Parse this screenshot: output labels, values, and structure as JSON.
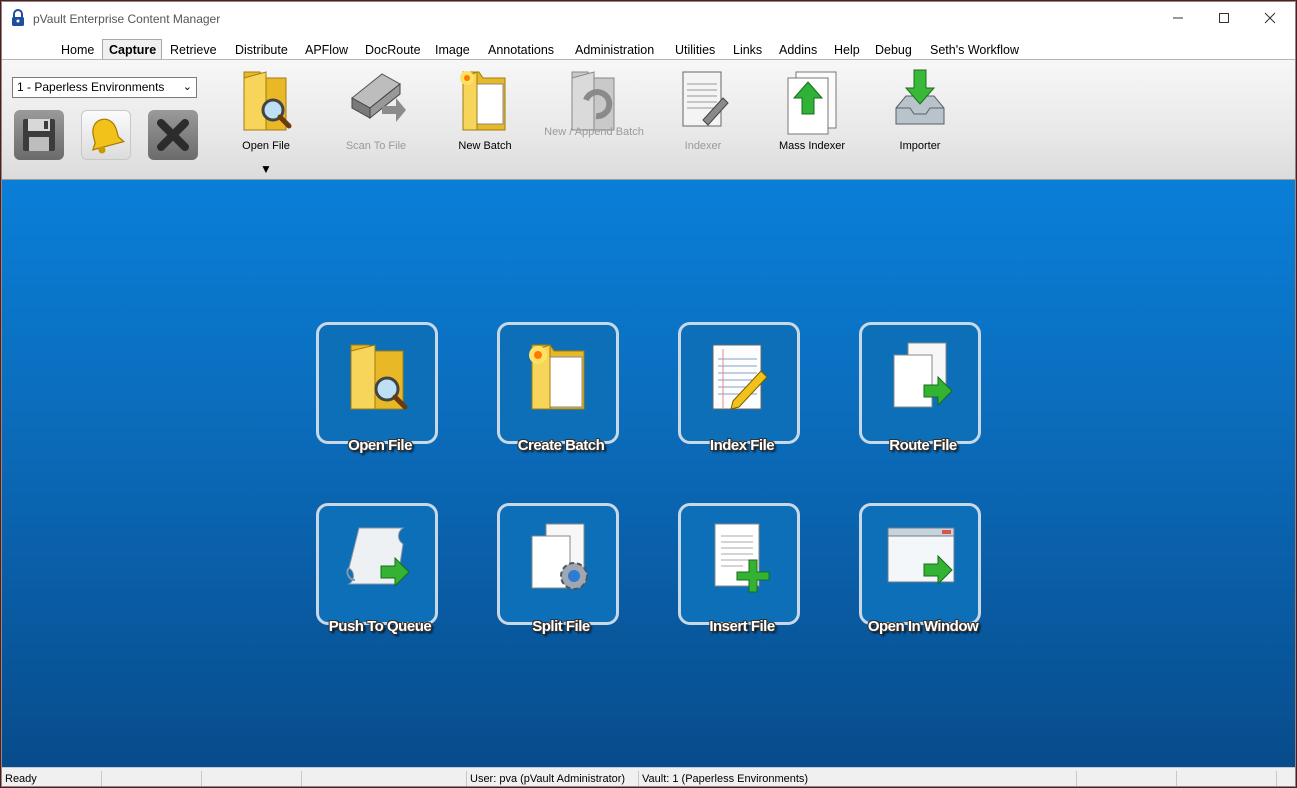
{
  "window": {
    "title": "pVault Enterprise Content Manager",
    "icon": "lock-icon"
  },
  "menu": {
    "tabs": [
      {
        "label": "Home"
      },
      {
        "label": "Capture",
        "active": true
      },
      {
        "label": "Retrieve"
      },
      {
        "label": "Distribute"
      },
      {
        "label": "APFlow"
      },
      {
        "label": "DocRoute"
      },
      {
        "label": "Image"
      },
      {
        "label": "Annotations"
      },
      {
        "label": "Administration"
      },
      {
        "label": "Utilities"
      },
      {
        "label": "Links"
      },
      {
        "label": "Addins"
      },
      {
        "label": "Help"
      },
      {
        "label": "Debug"
      },
      {
        "label": "Seth's Workflow"
      }
    ]
  },
  "toolbar": {
    "vault_selected": "1 - Paperless Environments",
    "small_buttons": [
      "save-icon",
      "bell-icon",
      "close-x-icon"
    ],
    "buttons": [
      {
        "label": "Open File",
        "icon": "folder-search-icon",
        "enabled": true,
        "has_dropdown": true
      },
      {
        "label": "Scan To File",
        "icon": "scanner-icon",
        "enabled": false
      },
      {
        "label": "New Batch",
        "icon": "new-batch-folder-icon",
        "enabled": true
      },
      {
        "label": "New / Append Batch",
        "icon": "append-batch-icon",
        "enabled": false
      },
      {
        "label": "Indexer",
        "icon": "notepad-pencil-icon",
        "enabled": false
      },
      {
        "label": "Mass Indexer",
        "icon": "mass-indexer-icon",
        "enabled": true
      },
      {
        "label": "Importer",
        "icon": "importer-tray-icon",
        "enabled": true
      }
    ]
  },
  "tiles": [
    {
      "label": "Open File",
      "icon": "folder-search-icon"
    },
    {
      "label": "Create Batch",
      "icon": "new-batch-folder-icon"
    },
    {
      "label": "Index File",
      "icon": "notepad-pencil-icon"
    },
    {
      "label": "Route File",
      "icon": "route-file-icon"
    },
    {
      "label": "Push To Queue",
      "icon": "scroll-arrow-icon"
    },
    {
      "label": "Split File",
      "icon": "split-file-gear-icon"
    },
    {
      "label": "Insert File",
      "icon": "insert-file-plus-icon"
    },
    {
      "label": "Open In Window",
      "icon": "window-arrow-icon"
    }
  ],
  "status": {
    "state": "Ready",
    "user": "User: pva (pVault Administrator)",
    "vault": "Vault: 1 (Paperless Environments)"
  },
  "colors": {
    "main_bg_top": "#0a7fd8",
    "main_bg_bottom": "#074c8c",
    "tile_bg": "#0c6fb8",
    "tile_border": "#c9d8e6",
    "disabled_text": "#9a9a9a"
  }
}
